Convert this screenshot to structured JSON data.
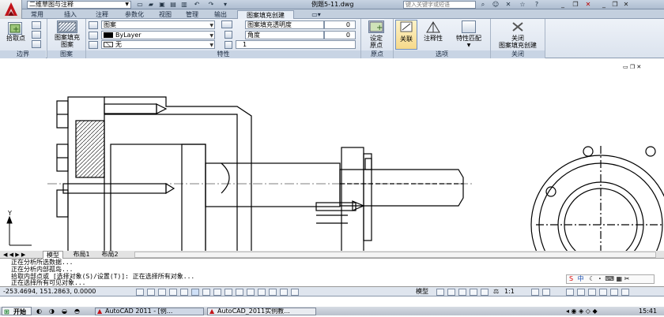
{
  "titlebar": {
    "workspace": "二维草图与注释",
    "file": "例题5-11.dwg",
    "search_placeholder": "键入关键字或短语"
  },
  "tabs": [
    "常用",
    "插入",
    "注释",
    "参数化",
    "视图",
    "管理",
    "输出",
    "图案填充创建"
  ],
  "ribbon": {
    "pick_point": "拾取点",
    "boundary_panel": "边界",
    "hatch_pattern_l1": "图案填充",
    "hatch_pattern_l2": "图案",
    "pattern_panel": "图案",
    "prop_type": "图案",
    "prop_color": "ByLayer",
    "prop_bg": "无",
    "transparency_label": "图案填充透明度",
    "transparency_value": "0",
    "angle_label": "角度",
    "angle_value": "0",
    "scale_value": "1",
    "properties_panel": "特性",
    "set_origin_l1": "设定",
    "set_origin_l2": "原点",
    "origin_panel": "原点",
    "associative": "关联",
    "annotative": "注释性",
    "match_props": "特性匹配",
    "options_panel": "选项",
    "close_l1": "关闭",
    "close_l2": "图案填充创建",
    "close_panel": "关闭"
  },
  "layout_tabs": [
    "模型",
    "布局1",
    "布局2"
  ],
  "command": {
    "lines": [
      "正在分析所选数据...",
      "正在分析内部孤岛...",
      "拾取内部点或 [选择对象(S)/设置(T)]: 正在选择所有对象...",
      "正在选择所有可见对象..."
    ]
  },
  "status": {
    "coords": "-253.4694, 151.2863, 0.0000",
    "model": "模型",
    "scale": "1:1"
  },
  "ime": {
    "label": "中"
  },
  "taskbar": {
    "start": "开始",
    "tasks": [
      "AutoCAD 2011 - [例...",
      "AutoCAD_2011实例教..."
    ],
    "clock": "15:41"
  }
}
